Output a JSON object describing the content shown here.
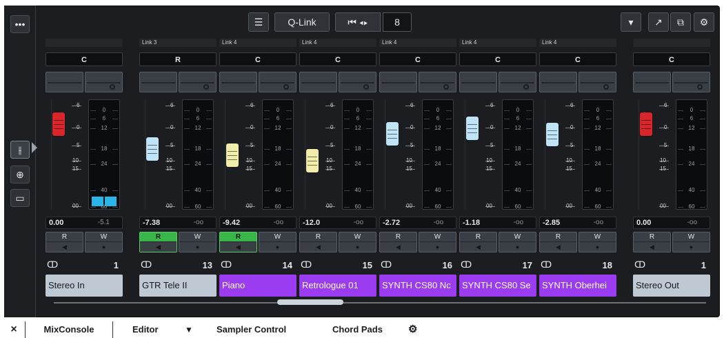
{
  "toolbar": {
    "qlink_label": "Q-Link",
    "number_value": "8",
    "icons": [
      "more-icon",
      "list-icon",
      "prev-next-icon",
      "zoom-icon",
      "dropdown-icon",
      "export-icon",
      "settings-icon"
    ]
  },
  "rail": {
    "icons": [
      "fader-icon",
      "routing-icon",
      "monitor-icon"
    ]
  },
  "strips": [
    {
      "link": "",
      "pan": "C",
      "value": "0.00",
      "peak": "-5.1",
      "number": "1",
      "name": "Stereo In",
      "color": "grey",
      "fader": "red",
      "fader_db": 0,
      "rw_on": false,
      "meter_lit": true
    },
    {
      "link": "Link 3",
      "pan": "R",
      "value": "-7.38",
      "peak": "-oo",
      "number": "13",
      "name": "GTR Tele II",
      "color": "grey",
      "fader": "blue",
      "fader_db": -7.38,
      "rw_on": true,
      "meter_lit": false
    },
    {
      "link": "Link 4",
      "pan": "C",
      "value": "-9.42",
      "peak": "-oo",
      "number": "14",
      "name": "Piano",
      "color": "purple",
      "fader": "yellow",
      "fader_db": -9.42,
      "rw_on": true,
      "meter_lit": false
    },
    {
      "link": "Link 4",
      "pan": "C",
      "value": "-12.0",
      "peak": "-oo",
      "number": "15",
      "name": "Retrologue 01",
      "color": "purple",
      "fader": "yellow",
      "fader_db": -12.0,
      "rw_on": false,
      "meter_lit": false
    },
    {
      "link": "Link 4",
      "pan": "C",
      "value": "-2.72",
      "peak": "-oo",
      "number": "16",
      "name": "SYNTH CS80 Nc",
      "color": "purple",
      "fader": "blue",
      "fader_db": -2.72,
      "rw_on": false,
      "meter_lit": false
    },
    {
      "link": "Link 4",
      "pan": "C",
      "value": "-1.18",
      "peak": "-oo",
      "number": "17",
      "name": "SYNTH CS80 Se",
      "color": "purple",
      "fader": "blue",
      "fader_db": -1.18,
      "rw_on": false,
      "meter_lit": false
    },
    {
      "link": "Link 4",
      "pan": "C",
      "value": "-2.85",
      "peak": "-oo",
      "number": "18",
      "name": "SYNTH Oberhei",
      "color": "purple",
      "fader": "blue",
      "fader_db": -2.85,
      "rw_on": false,
      "meter_lit": false
    },
    {
      "link": "",
      "pan": "C",
      "value": "0.00",
      "peak": "-oo",
      "number": "1",
      "name": "Stereo Out",
      "color": "grey",
      "fader": "red",
      "fader_db": 0,
      "rw_on": false,
      "meter_lit": false
    }
  ],
  "scale_labels": [
    "6",
    "0",
    "5",
    "10",
    "15",
    "00"
  ],
  "meter_labels": [
    "0",
    "6",
    "12",
    "18",
    "24",
    "40",
    "60"
  ],
  "rw_labels": {
    "read": "R",
    "write": "W"
  },
  "tabs": {
    "close": "×",
    "mixconsole": "MixConsole",
    "editor": "Editor",
    "sampler": "Sampler Control",
    "chordpads": "Chord Pads"
  },
  "colors": {
    "purple": "#9b3cf0",
    "grey": "#bfc9d3",
    "red": "#d9262b",
    "blue": "#bfe3f7",
    "yellow": "#f1ecaa",
    "green": "#39b54a",
    "meter": "#2ab5e8"
  }
}
